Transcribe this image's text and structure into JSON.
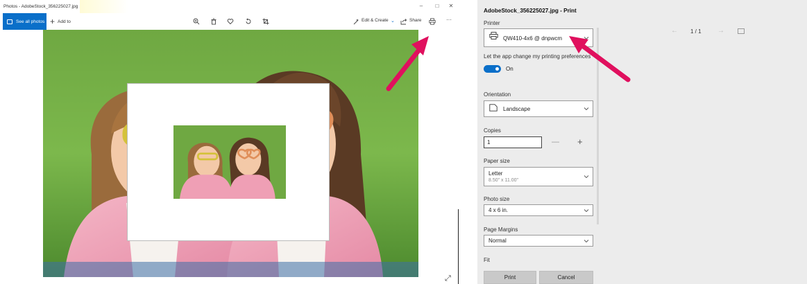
{
  "photos_app": {
    "window_title": "Photos - AdobeStock_356225027.jpg",
    "window_controls": {
      "minimize": "–",
      "maximize": "□",
      "close": "✕"
    },
    "toolbar": {
      "see_all_photos": "See all photos",
      "add_to": "Add to",
      "edit_create": "Edit & Create",
      "share": "Share",
      "more": "···"
    },
    "icons": [
      "zoom-in-icon",
      "delete-icon",
      "heart-icon",
      "rotate-icon",
      "crop-icon",
      "edit-create-icon",
      "share-icon",
      "print-icon",
      "expand-icon"
    ]
  },
  "print_dialog": {
    "title": "AdobeStock_356225027.jpg - Print",
    "printer": {
      "label": "Printer",
      "value": "QW410-4x6 @ dnpwcm"
    },
    "app_pref": {
      "label": "Let the app change my printing preferences",
      "toggle": "On"
    },
    "orientation": {
      "label": "Orientation",
      "value": "Landscape"
    },
    "copies": {
      "label": "Copies",
      "value": "1",
      "minus": "—",
      "plus": "+"
    },
    "paper_size": {
      "label": "Paper size",
      "value": "Letter",
      "detail": "8.50\" x 11.00\""
    },
    "photo_size": {
      "label": "Photo size",
      "value": "4 x 6 in."
    },
    "page_margins": {
      "label": "Page Margins",
      "value": "Normal"
    },
    "fit": {
      "label": "Fit"
    },
    "buttons": {
      "print": "Print",
      "cancel": "Cancel"
    },
    "preview_nav": {
      "pages": "1  /  1",
      "prev": "←",
      "next": "→"
    }
  },
  "colors": {
    "accent": "#0a6fc9",
    "arrow": "#e0105e",
    "dialog_bg": "#ececec"
  }
}
